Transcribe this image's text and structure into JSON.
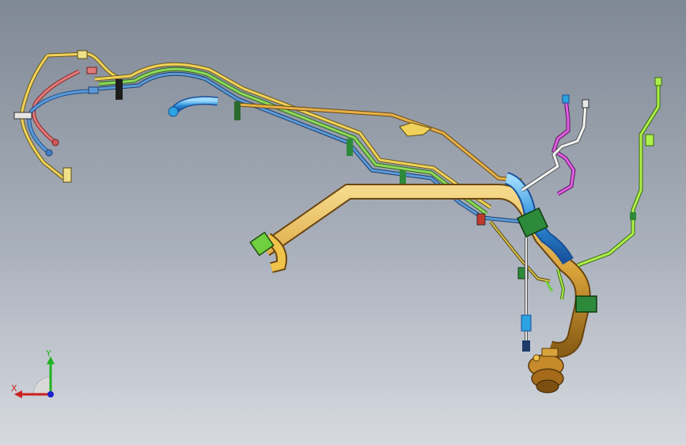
{
  "viewport": {
    "background_top": "#7f8895",
    "background_bottom": "#d6d9df"
  },
  "model": {
    "hose_colors": {
      "yellow": "#e6c13a",
      "green": "#6fcf3f",
      "blue": "#3f7fc2",
      "red": "#d25a5a",
      "orange": "#d49a2a",
      "cyan": "#2aa3e0",
      "magenta": "#cc3fc6",
      "white": "#f0f0f0",
      "lime": "#8fd83a",
      "clip_green": "#2d8a3a",
      "clip_black": "#1d1d1d"
    }
  },
  "triad": {
    "x_label": "X",
    "y_label": "Y",
    "x_color": "#cc1f1f",
    "y_color": "#1fb31f",
    "z_color": "#1f1fcc"
  }
}
